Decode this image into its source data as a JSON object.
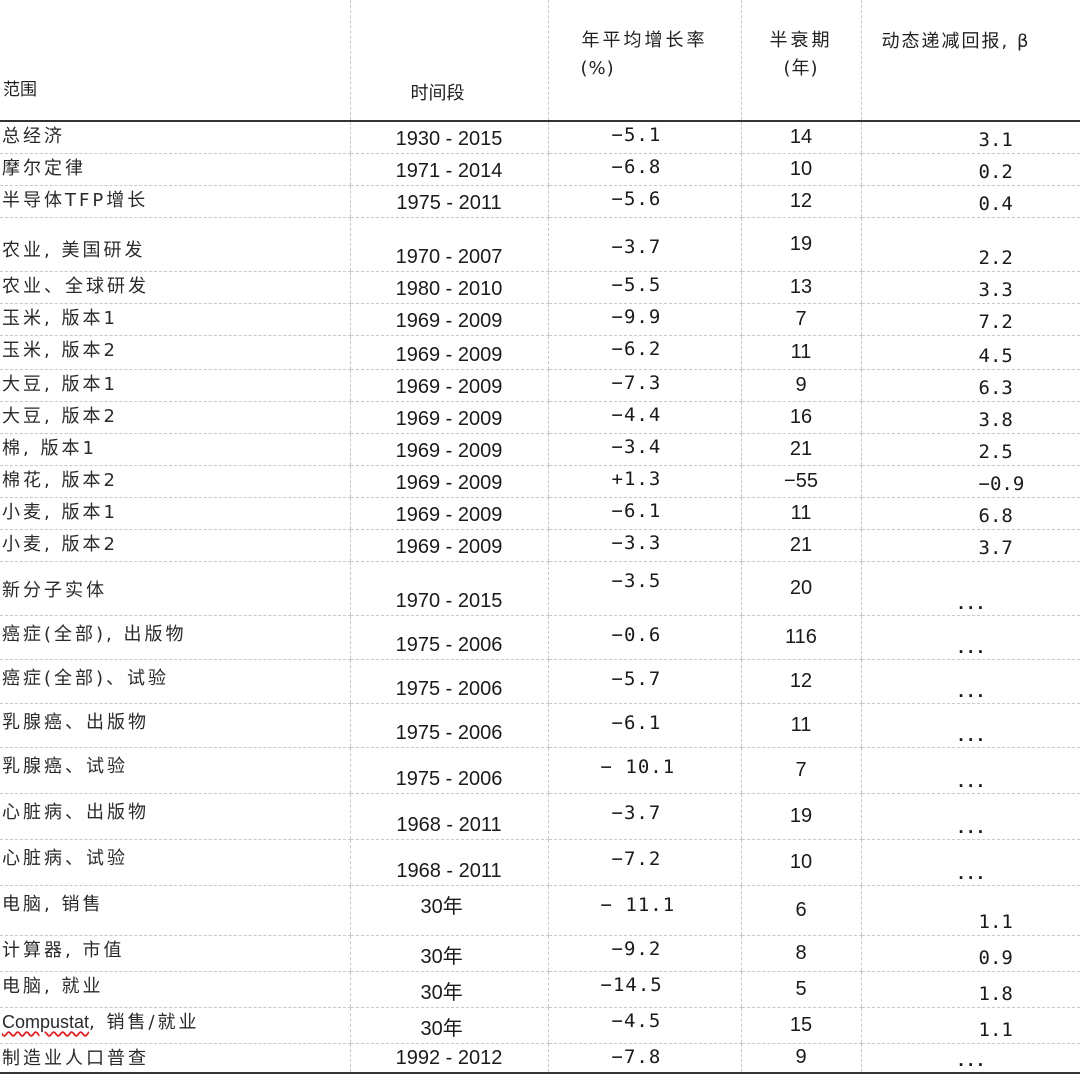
{
  "headers": {
    "scope": "范围",
    "period": "时间段",
    "growth_line1": "年平均增长率",
    "growth_line2": "(%)",
    "halflife_line1": "半衰期",
    "halflife_line2": "(年)",
    "beta": "动态递减回报, β"
  },
  "rows": [
    {
      "name": "总经济",
      "period": "1930 - 2015",
      "rate": "−5.1",
      "half": "14",
      "beta": "3.1"
    },
    {
      "name": "摩尔定律",
      "period": "1971 - 2014",
      "rate": "−6.8",
      "half": "10",
      "beta": "0.2"
    },
    {
      "name": "半导体TFP增长",
      "period": "1975 - 2011",
      "rate": "−5.6",
      "half": "12",
      "beta": "0.4"
    },
    {
      "name": "农业, 美国研发",
      "period": "1970 - 2007",
      "rate": "−3.7",
      "half": "19",
      "beta": "2.2"
    },
    {
      "name": "农业、全球研发",
      "period": "1980 - 2010",
      "rate": "−5.5",
      "half": "13",
      "beta": "3.3"
    },
    {
      "name": "玉米, 版本1",
      "period": "1969 - 2009",
      "rate": "−9.9",
      "half": "7",
      "beta": "7.2"
    },
    {
      "name": "玉米, 版本2",
      "period": "1969 - 2009",
      "rate": "−6.2",
      "half": "11",
      "beta": "4.5"
    },
    {
      "name": "大豆, 版本1",
      "period": "1969 - 2009",
      "rate": "−7.3",
      "half": "9",
      "beta": "6.3"
    },
    {
      "name": "大豆, 版本2",
      "period": "1969 - 2009",
      "rate": "−4.4",
      "half": "16",
      "beta": "3.8"
    },
    {
      "name": "棉, 版本1",
      "period": "1969 - 2009",
      "rate": "−3.4",
      "half": "21",
      "beta": "2.5"
    },
    {
      "name": "棉花, 版本2",
      "period": "1969 - 2009",
      "rate": "+1.3",
      "half": "−55",
      "beta": "−0.9"
    },
    {
      "name": "小麦, 版本1",
      "period": "1969 - 2009",
      "rate": "−6.1",
      "half": "11",
      "beta": "6.8"
    },
    {
      "name": "小麦, 版本2",
      "period": "1969 - 2009",
      "rate": "−3.3",
      "half": "21",
      "beta": "3.7"
    },
    {
      "name": "新分子实体",
      "period": "1970 - 2015",
      "rate": "−3.5",
      "half": "20",
      "beta": "..."
    },
    {
      "name": "癌症(全部), 出版物",
      "period": "1975 - 2006",
      "rate": "−0.6",
      "half": "116",
      "beta": "..."
    },
    {
      "name": "癌症(全部)、试验",
      "period": "1975 - 2006",
      "rate": "−5.7",
      "half": "12",
      "beta": "..."
    },
    {
      "name": "乳腺癌、出版物",
      "period": "1975 - 2006",
      "rate": "−6.1",
      "half": "11",
      "beta": "..."
    },
    {
      "name": "乳腺癌、试验",
      "period": "1975 - 2006",
      "rate": "− 10.1",
      "half": "7",
      "beta": "..."
    },
    {
      "name": "心脏病、出版物",
      "period": "1968 - 2011",
      "rate": "−3.7",
      "half": "19",
      "beta": "..."
    },
    {
      "name": "心脏病、试验",
      "period": "1968 - 2011",
      "rate": "−7.2",
      "half": "10",
      "beta": "..."
    },
    {
      "name": "电脑, 销售",
      "period": "30年",
      "rate": "− 11.1",
      "half": "6",
      "beta": "1.1"
    },
    {
      "name": "计算器, 市值",
      "period": "30年",
      "rate": "−9.2",
      "half": "8",
      "beta": "0.9"
    },
    {
      "name": "电脑, 就业",
      "period": "30年",
      "rate": "−14.5",
      "half": "5",
      "beta": "1.8"
    },
    {
      "name_prefix": "Compustat",
      "name_suffix": ", 销售/就业",
      "period": "30年",
      "rate": "−4.5",
      "half": "15",
      "beta": "1.1"
    },
    {
      "name": "制造业人口普查",
      "period": "1992 - 2012",
      "rate": "−7.8",
      "half": "9",
      "beta": "..."
    }
  ]
}
